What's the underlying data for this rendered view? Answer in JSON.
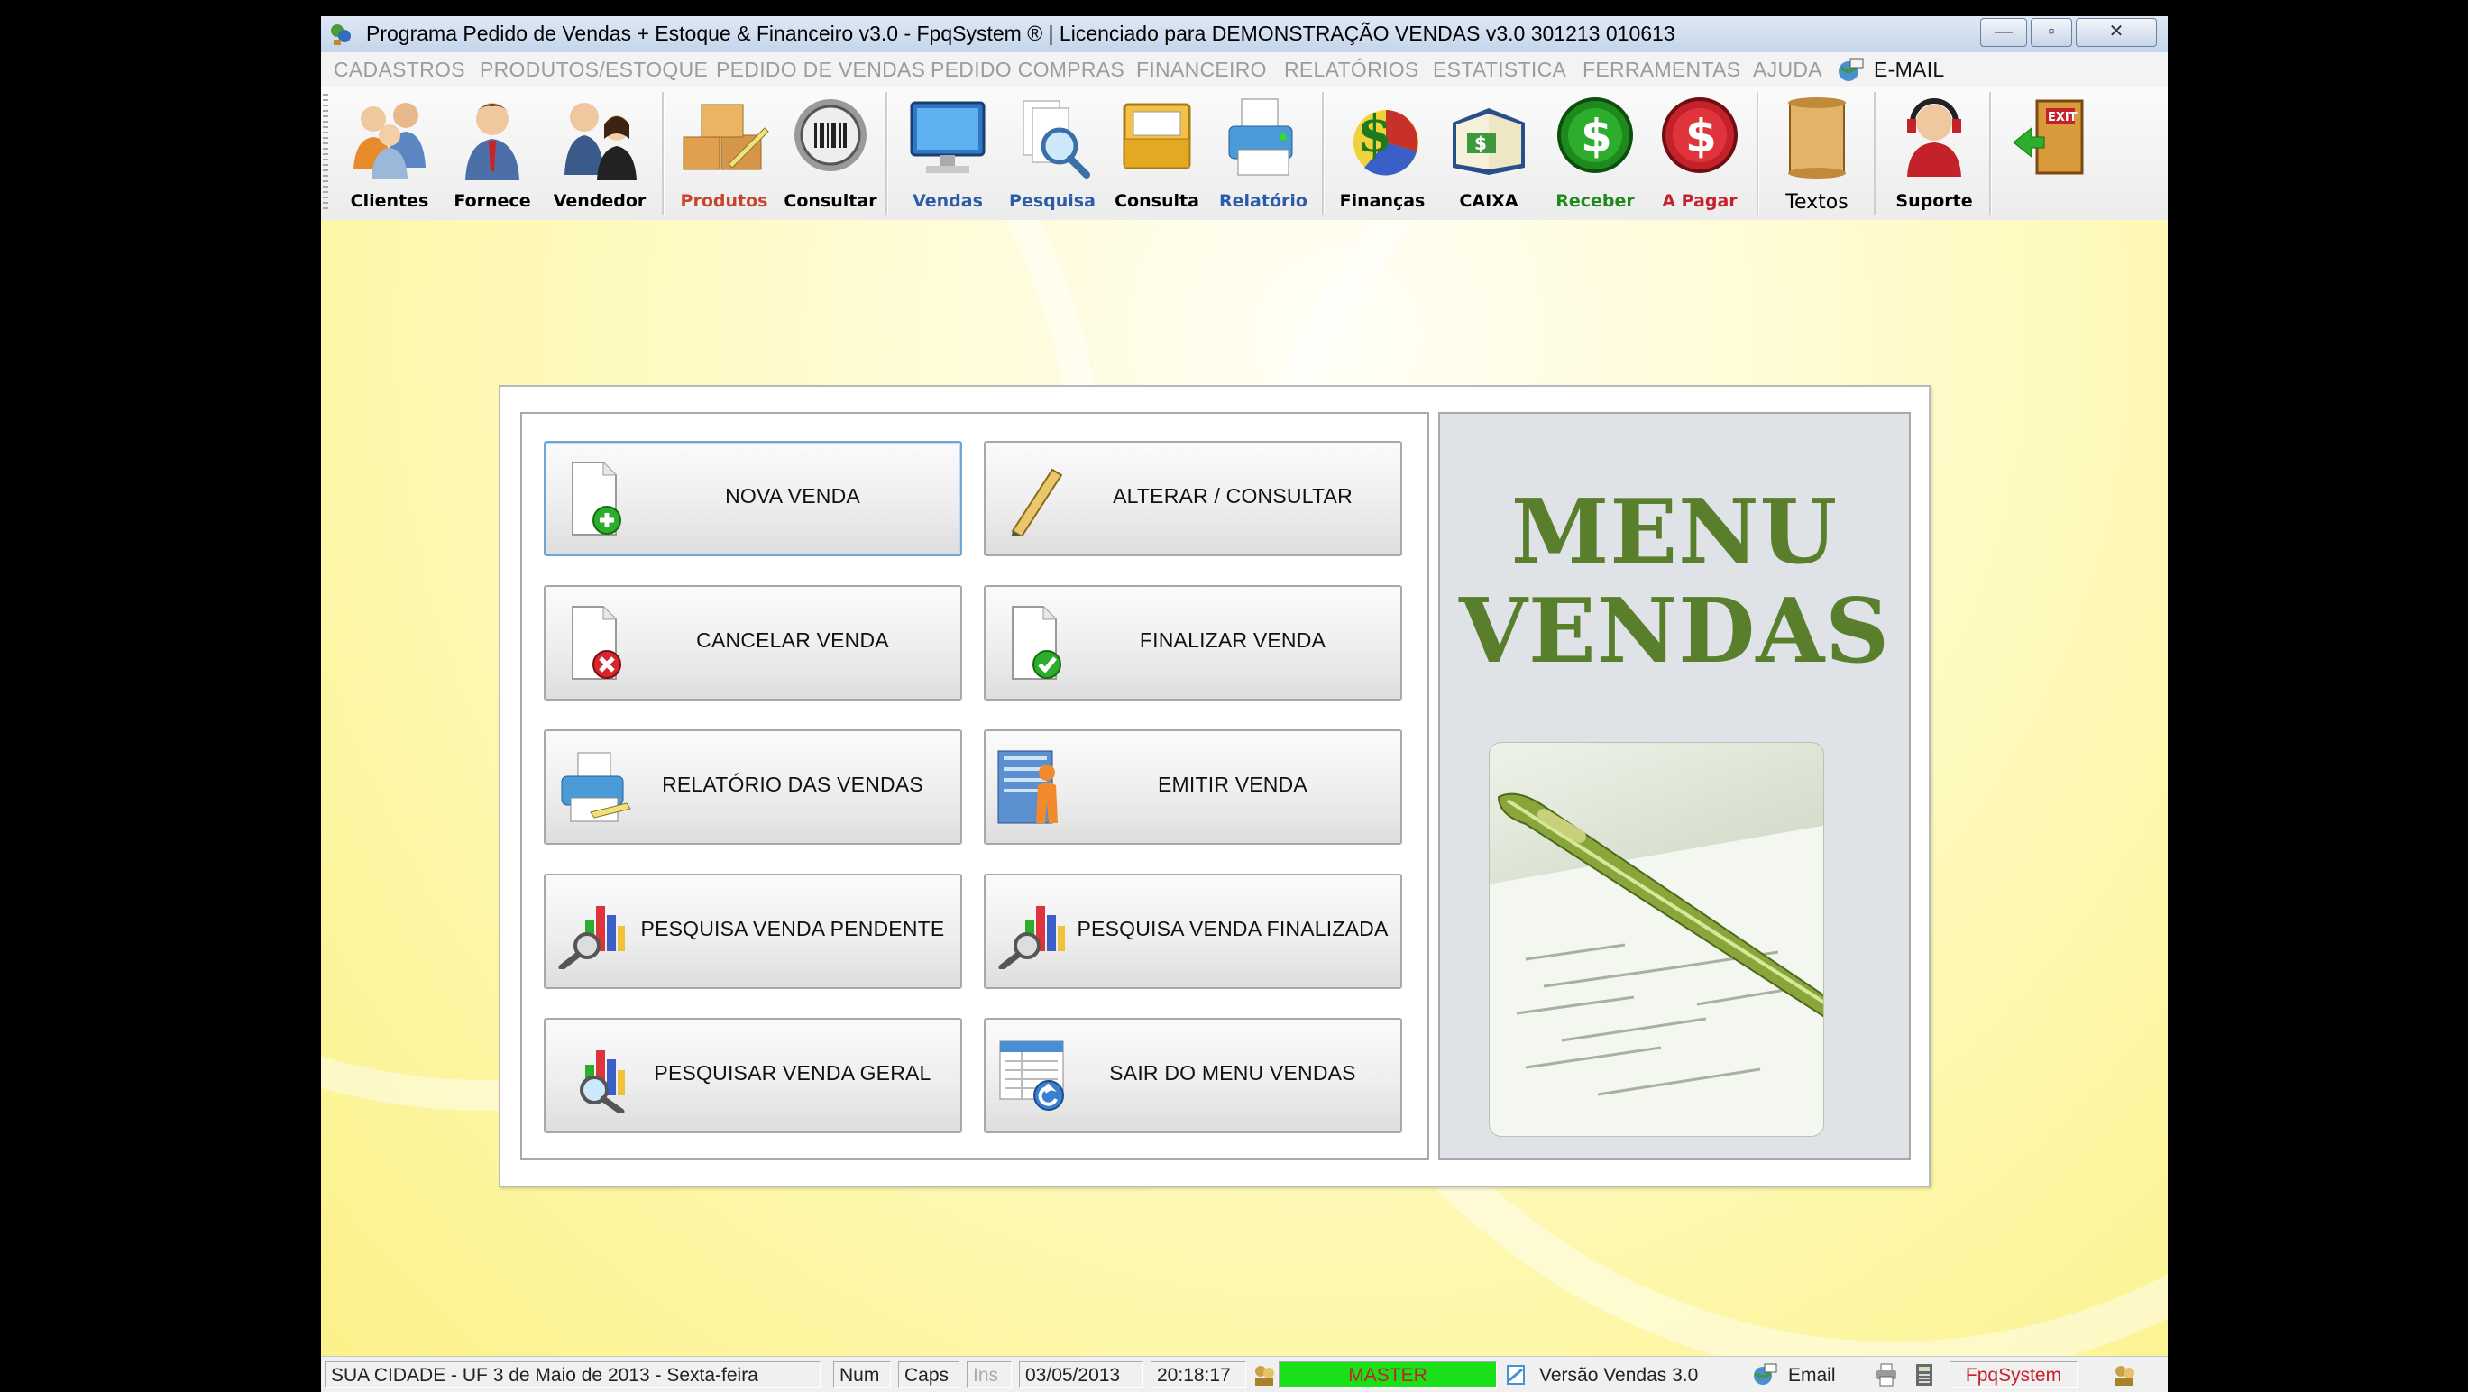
{
  "window": {
    "title": "Programa Pedido de Vendas + Estoque & Financeiro v3.0 - FpqSystem ® | Licenciado para  DEMONSTRAÇÃO VENDAS v3.0 301213 010613",
    "controls": {
      "minimize": "—",
      "maximize": "▫",
      "close": "✕"
    }
  },
  "menubar": {
    "items": [
      "CADASTROS",
      "PRODUTOS/ESTOQUE",
      "PEDIDO DE VENDAS",
      "PEDIDO COMPRAS",
      "FINANCEIRO",
      "RELATÓRIOS",
      "ESTATISTICA",
      "FERRAMENTAS",
      "AJUDA"
    ],
    "email": "E-MAIL"
  },
  "toolbar": {
    "buttons": [
      {
        "label": "Clientes",
        "icon": "clients-icon"
      },
      {
        "label": "Fornece",
        "icon": "supplier-icon"
      },
      {
        "label": "Vendedor",
        "icon": "seller-icon"
      },
      {
        "label": "Produtos",
        "icon": "boxes-icon"
      },
      {
        "label": "Consultar",
        "icon": "barcode-icon"
      },
      {
        "label": "Vendas",
        "icon": "monitor-icon"
      },
      {
        "label": "Pesquisa",
        "icon": "magnifier-icon"
      },
      {
        "label": "Consulta",
        "icon": "tray-icon"
      },
      {
        "label": "Relatório",
        "icon": "printer-icon"
      },
      {
        "label": "Finanças",
        "icon": "finance-chart-icon"
      },
      {
        "label": "CAIXA",
        "icon": "cash-book-icon"
      },
      {
        "label": "Receber",
        "icon": "receive-dollar-icon"
      },
      {
        "label": "A Pagar",
        "icon": "pay-dollar-icon"
      },
      {
        "label": "Textos",
        "icon": "scroll-icon"
      },
      {
        "label": "Suporte",
        "icon": "support-icon"
      },
      {
        "label": "",
        "icon": "exit-door-icon"
      }
    ],
    "colors": {
      "produtos": "#c8442b",
      "vendas": "#2a5ca8",
      "receber": "#1e8a1e",
      "apagar": "#c4222b"
    }
  },
  "menu": {
    "buttons": [
      {
        "label": "NOVA VENDA",
        "icon": "new-document-icon"
      },
      {
        "label": "ALTERAR / CONSULTAR",
        "icon": "pencil-icon"
      },
      {
        "label": "CANCELAR VENDA",
        "icon": "cancel-document-icon"
      },
      {
        "label": "FINALIZAR VENDA",
        "icon": "check-document-icon"
      },
      {
        "label": "RELATÓRIO DAS VENDAS",
        "icon": "printer-icon"
      },
      {
        "label": "EMITIR VENDA",
        "icon": "emit-person-icon"
      },
      {
        "label": "PESQUISA VENDA PENDENTE",
        "icon": "search-chart-icon"
      },
      {
        "label": "PESQUISA VENDA FINALIZADA",
        "icon": "search-chart-icon"
      },
      {
        "label": "PESQUISAR VENDA GERAL",
        "icon": "search-chart-icon"
      },
      {
        "label": "SAIR DO MENU VENDAS",
        "icon": "exit-list-icon"
      }
    ],
    "heading_line1": "MENU",
    "heading_line2": "VENDAS",
    "heading_color": "#5a7f2c"
  },
  "statusbar": {
    "location": "SUA CIDADE - UF  3 de Maio de 2013 - Sexta-feira",
    "num": "Num",
    "caps": "Caps",
    "ins": "Ins",
    "date": "03/05/2013",
    "time": "20:18:17",
    "user": "MASTER",
    "version": "Versão Vendas 3.0",
    "email": "Email",
    "brand": "FpqSystem"
  }
}
